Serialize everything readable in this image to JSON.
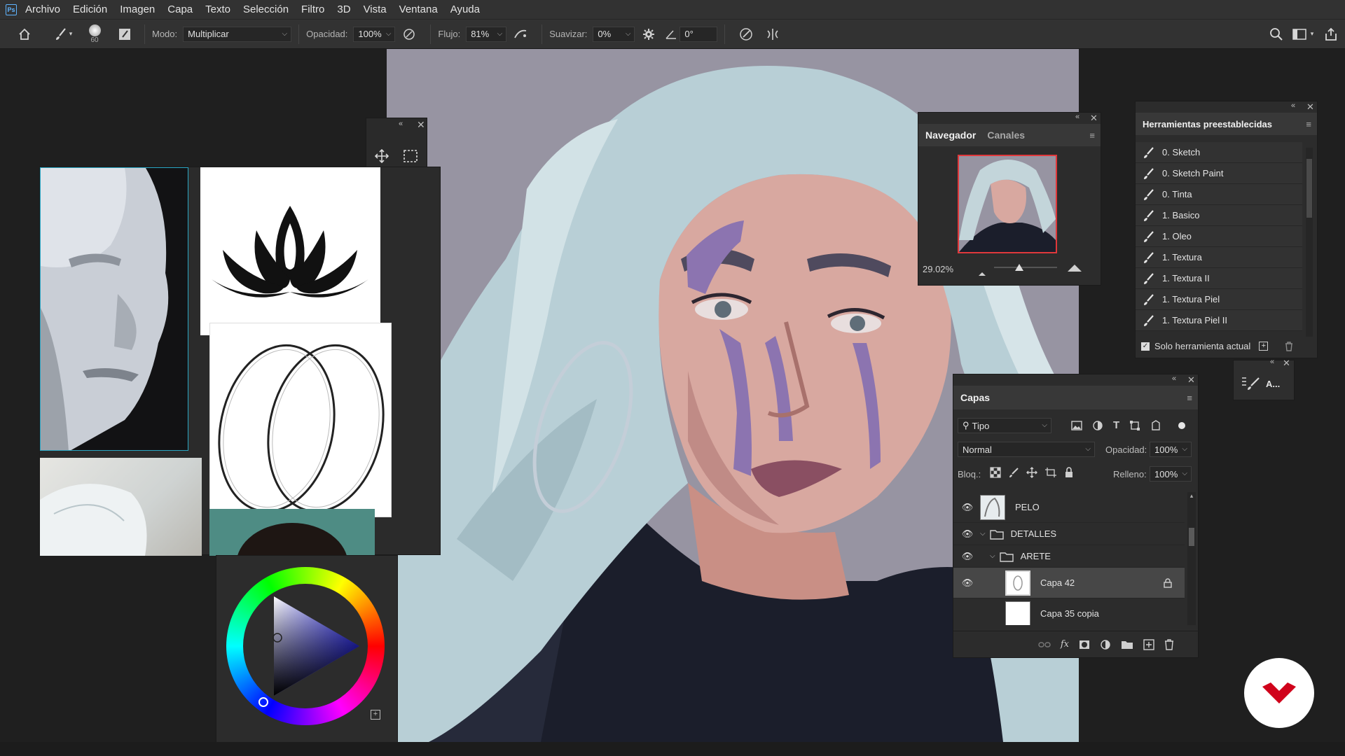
{
  "menu": {
    "logo": "Ps",
    "items": [
      "Archivo",
      "Edición",
      "Imagen",
      "Capa",
      "Texto",
      "Selección",
      "Filtro",
      "3D",
      "Vista",
      "Ventana",
      "Ayuda"
    ]
  },
  "options": {
    "brush_size": "60",
    "mode_label": "Modo:",
    "mode_value": "Multiplicar",
    "opacity_label": "Opacidad:",
    "opacity_value": "100%",
    "flow_label": "Flujo:",
    "flow_value": "81%",
    "smooth_label": "Suavizar:",
    "smooth_value": "0%",
    "angle_value": "0°"
  },
  "navigator": {
    "tab_active": "Navegador",
    "tab_inactive": "Canales",
    "zoom": "29.02%"
  },
  "presets": {
    "title": "Herramientas preestablecidas",
    "items": [
      "0. Sketch",
      "0. Sketch Paint",
      "0. Tinta",
      "1. Basico",
      "1. Oleo",
      "1. Textura",
      "1. Textura II",
      "1. Textura Piel",
      "1. Textura Piel II"
    ],
    "footer_label": "Solo herramienta actual"
  },
  "mini_panel": {
    "label": "A..."
  },
  "layers": {
    "title": "Capas",
    "filter_kind": "Tipo",
    "blend_mode": "Normal",
    "opacity_label": "Opacidad:",
    "opacity_value": "100%",
    "lock_label": "Bloq.:",
    "fill_label": "Relleno:",
    "fill_value": "100%",
    "rows": [
      {
        "name": "PELO",
        "type": "layer"
      },
      {
        "name": "DETALLES",
        "type": "group"
      },
      {
        "name": "ARETE",
        "type": "group"
      },
      {
        "name": "Capa 42",
        "type": "layer"
      },
      {
        "name": "Capa 35 copia",
        "type": "layer"
      }
    ],
    "fx_label": "fx"
  },
  "colors": {
    "accent": "#5fb4ff",
    "panel_bg": "#2c2c2c",
    "navigator_frame": "#e0383b",
    "logo_red": "#d0021b"
  }
}
